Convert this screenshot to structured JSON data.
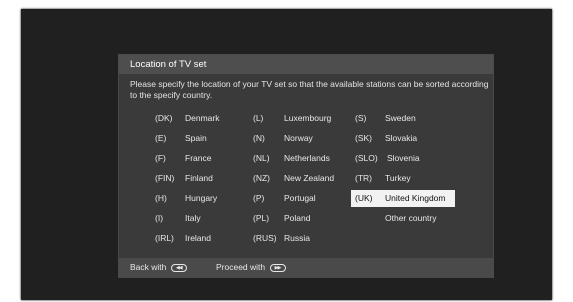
{
  "dialog": {
    "title": "Location of TV set",
    "instructions": "Please specify the location of your TV set so that the available stations can be sorted according to the specify country."
  },
  "countries": [
    {
      "code": "(DK)",
      "name": "Denmark"
    },
    {
      "code": "(E)",
      "name": "Spain"
    },
    {
      "code": "(F)",
      "name": "France"
    },
    {
      "code": "(FIN)",
      "name": "Finland"
    },
    {
      "code": "(H)",
      "name": "Hungary"
    },
    {
      "code": "(I)",
      "name": "Italy"
    },
    {
      "code": "(IRL)",
      "name": "Ireland"
    },
    {
      "code": "(L)",
      "name": "Luxembourg"
    },
    {
      "code": "(N)",
      "name": "Norway"
    },
    {
      "code": "(NL)",
      "name": "Netherlands"
    },
    {
      "code": "(NZ)",
      "name": "New Zealand"
    },
    {
      "code": "(P)",
      "name": "Portugal"
    },
    {
      "code": "(PL)",
      "name": "Poland"
    },
    {
      "code": "(RUS)",
      "name": "Russia"
    },
    {
      "code": "(S)",
      "name": "Sweden"
    },
    {
      "code": "(SK)",
      "name": "Slovakia"
    },
    {
      "code": "(SLO)",
      "name": "Slovenia"
    },
    {
      "code": "(TR)",
      "name": "Turkey"
    },
    {
      "code": "(UK)",
      "name": "United Kingdom"
    },
    {
      "code": "",
      "name": "Other country"
    }
  ],
  "selected_country": "United Kingdom",
  "footer": {
    "back_label": "Back with",
    "back_key_icon": "rewind-key-icon",
    "proceed_label": "Proceed with",
    "proceed_key_icon": "fast-forward-key-icon"
  }
}
